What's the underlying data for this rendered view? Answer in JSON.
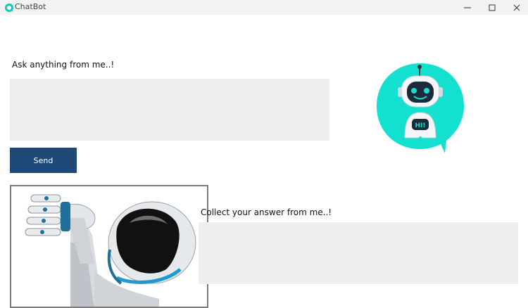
{
  "window": {
    "title": "ChatBot",
    "app_icon": "chatbot-icon",
    "controls": [
      "minimize-icon",
      "maximize-icon",
      "close-icon"
    ]
  },
  "question": {
    "label": "Ask anything from me..!",
    "value": ""
  },
  "send_button": {
    "label": "Send"
  },
  "answer": {
    "label": "Collect your answer from me..!",
    "value": ""
  },
  "bot_logo": {
    "badge_text": "HI!",
    "accent_color": "#14e0d0"
  },
  "colors": {
    "send_button_bg": "#1f4a78",
    "input_bg": "#eeeeee"
  }
}
